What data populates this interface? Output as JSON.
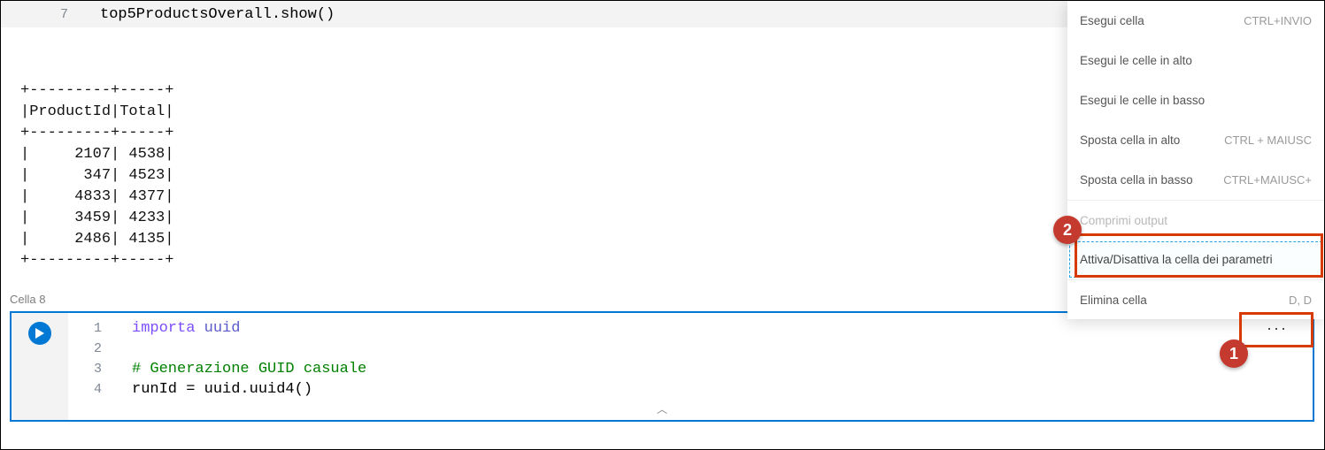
{
  "top_cell": {
    "line_number": "7",
    "code": "top5ProductsOverall.show()"
  },
  "output_lines": [
    "+---------+-----+",
    "|ProductId|Total|",
    "+---------+-----+",
    "|     2107| 4538|",
    "|      347| 4523|",
    "|     4833| 4377|",
    "|     3459| 4233|",
    "|     2486| 4135|",
    "+---------+-----+"
  ],
  "cell_label": "Cella 8",
  "active_cell": {
    "lines": [
      "1",
      "2",
      "3",
      "4"
    ],
    "code": {
      "l1_kw": "importa",
      "l1_mod": "uuid",
      "l3_comment": "#   Generazione GUID casuale",
      "l4": "runId = uuid.uuid4()"
    },
    "more_label": "···"
  },
  "menu": {
    "items": [
      {
        "label": "Esegui cella",
        "shortcut": "CTRL+INVIO"
      },
      {
        "label": "Esegui le celle in alto",
        "shortcut": ""
      },
      {
        "label": "Esegui le celle in basso",
        "shortcut": ""
      },
      {
        "label": "Sposta cella in alto",
        "shortcut": "CTRL + MAIUSC"
      },
      {
        "label": "Sposta cella in basso",
        "shortcut": "CTRL+MAIUSC+"
      },
      {
        "label": "Comprimi output",
        "shortcut": "",
        "disabled": true
      },
      {
        "label": "Attiva/Disattiva la cella dei parametri",
        "shortcut": "",
        "highlight": true
      },
      {
        "label": "Elimina cella",
        "shortcut": "D, D"
      }
    ]
  },
  "annotations": {
    "callout1": "1",
    "callout2": "2"
  },
  "chart_data": {
    "type": "table",
    "columns": [
      "ProductId",
      "Total"
    ],
    "rows": [
      [
        2107,
        4538
      ],
      [
        347,
        4523
      ],
      [
        4833,
        4377
      ],
      [
        3459,
        4233
      ],
      [
        2486,
        4135
      ]
    ]
  }
}
